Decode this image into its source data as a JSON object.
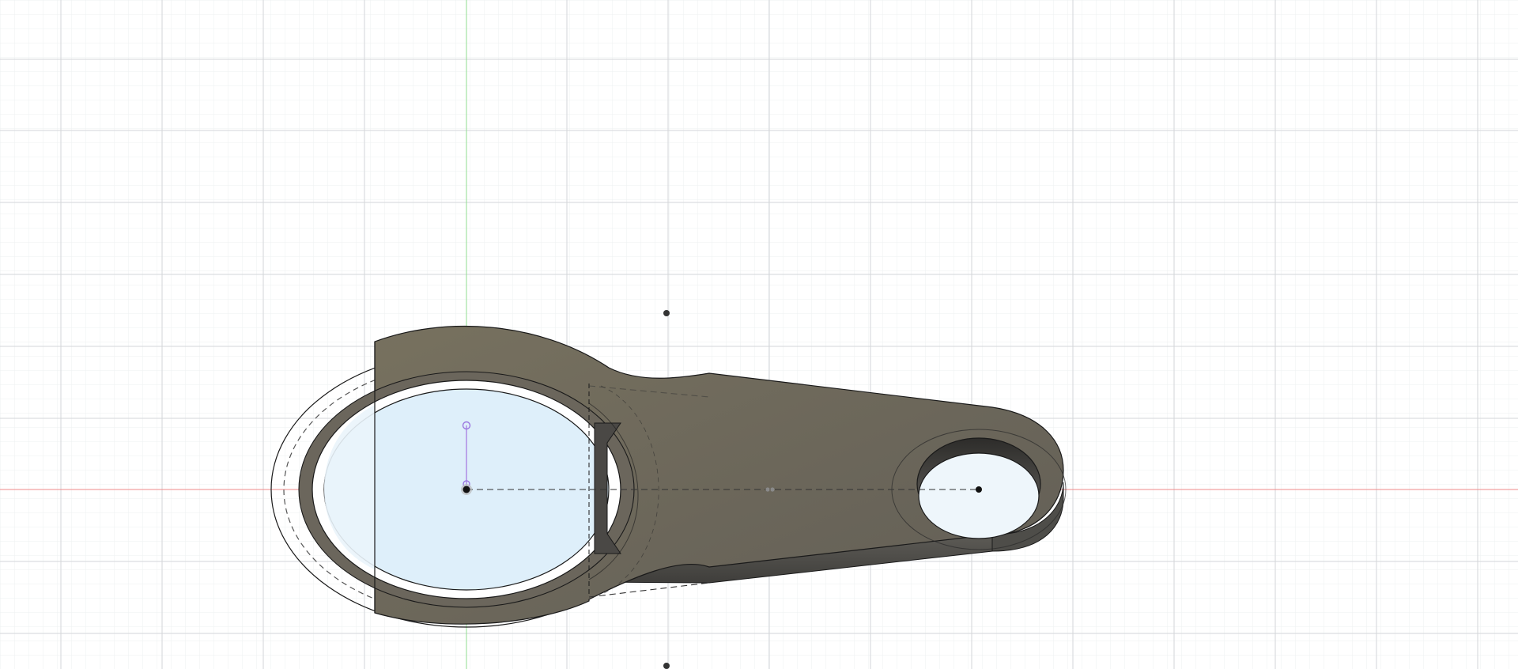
{
  "app": {
    "view": "3d-viewport",
    "mode": "sketch-edit"
  },
  "colors": {
    "background": "#ffffff",
    "grid_minor": "#eef0f2",
    "grid_major": "#d6d9dc",
    "axis_x": "#ef8a8a",
    "axis_y": "#8fdc8f",
    "body_face": "#6f6a61",
    "body_side": "#55534e",
    "profile_fill": "#dff0fa",
    "sketch_line": "#1a1a1a",
    "constraint": "#b191e6"
  },
  "icons": {
    "origin_point": "filled-circle",
    "sketch_point": "filled-circle",
    "midpoint_marker": "double-dot",
    "constraint_handle": "hollow-circle"
  }
}
